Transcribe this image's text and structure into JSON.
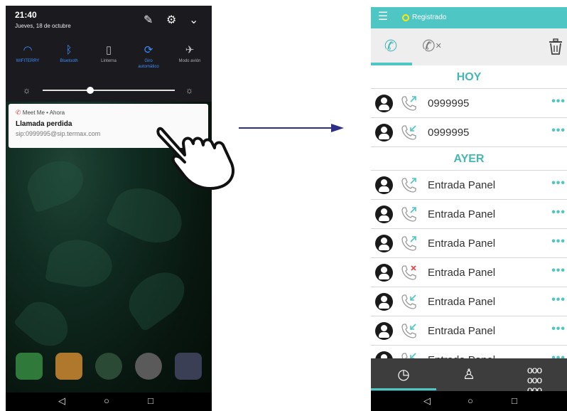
{
  "left_phone": {
    "status": {
      "time": "21:40",
      "date": "Jueves, 18 de octubre",
      "icons": [
        "pencil-icon",
        "gear-icon",
        "chevron-down-icon"
      ]
    },
    "quick_settings": [
      {
        "label": "WIFITERRY",
        "icon": "wifi-icon",
        "active": true
      },
      {
        "label": "Bluetooth",
        "icon": "bluetooth-icon",
        "active": true
      },
      {
        "label": "Linterna",
        "icon": "flashlight-icon",
        "active": false
      },
      {
        "label": "Giro automático",
        "icon": "rotate-icon",
        "active": true
      },
      {
        "label": "Modo avión",
        "icon": "airplane-icon",
        "active": false
      }
    ],
    "notification": {
      "app": "Meet Me • Ahora",
      "title": "Llamada perdida",
      "body": "sip:0999995@sip.termax.com"
    },
    "nav": [
      "back-icon",
      "home-icon",
      "recents-icon"
    ]
  },
  "right_phone": {
    "header": {
      "status": "Registrado"
    },
    "tabs": [
      "all-calls-tab",
      "missed-calls-tab"
    ],
    "sections": [
      {
        "title": "HOY",
        "rows": [
          {
            "label": "0999995",
            "call_type": "outgoing"
          },
          {
            "label": "0999995",
            "call_type": "incoming"
          }
        ]
      },
      {
        "title": "AYER",
        "rows": [
          {
            "label": "Entrada Panel",
            "call_type": "outgoing"
          },
          {
            "label": "Entrada Panel",
            "call_type": "outgoing"
          },
          {
            "label": "Entrada Panel",
            "call_type": "outgoing"
          },
          {
            "label": "Entrada Panel",
            "call_type": "missed"
          },
          {
            "label": "Entrada Panel",
            "call_type": "incoming"
          },
          {
            "label": "Entrada Panel",
            "call_type": "incoming"
          },
          {
            "label": "Entrada Panel",
            "call_type": "incoming"
          }
        ]
      }
    ],
    "more_label": "•••",
    "bottom_nav": [
      "history-icon",
      "contacts-icon",
      "keypad-icon"
    ]
  },
  "colors": {
    "accent": "#4ec7c4",
    "accent_text": "#47b7b4",
    "registered_dot": "#ffea00",
    "missed": "#e04a4a",
    "arrow": "#2b2f86"
  }
}
